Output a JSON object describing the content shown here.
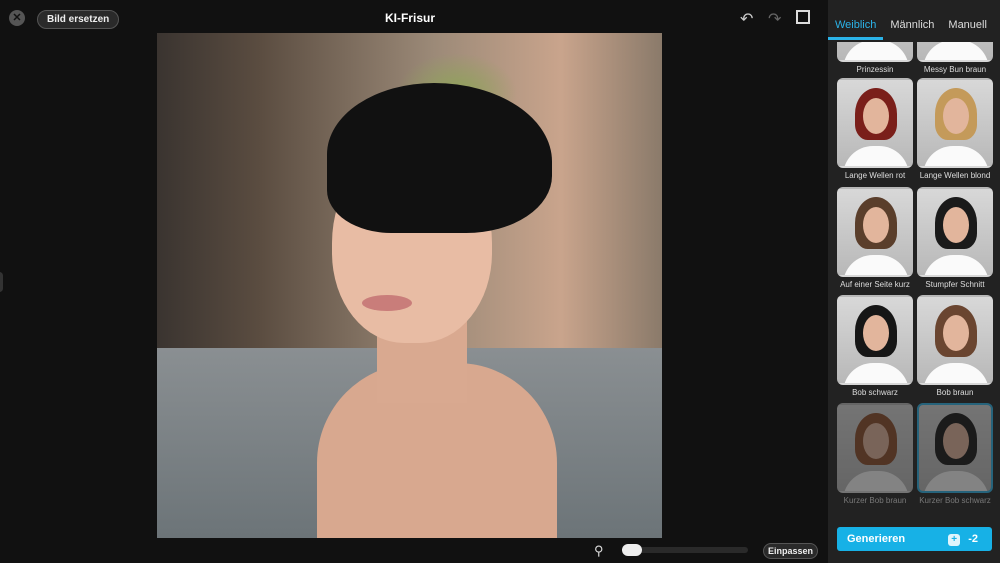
{
  "header": {
    "close_icon": "close-icon",
    "replace_label": "Bild ersetzen",
    "title": "KI-Frisur",
    "undo_icon": "undo-icon",
    "redo_icon": "redo-icon",
    "compare_icon": "compare-icon"
  },
  "canvas": {
    "zoom_icon": "search-icon",
    "zoom_level": 0,
    "fit_label": "Einpassen"
  },
  "panel": {
    "tabs": [
      {
        "label": "Weiblich",
        "active": true
      },
      {
        "label": "Männlich"
      },
      {
        "label": "Manuell"
      }
    ],
    "styles": [
      {
        "label": "Prinzessin",
        "hair": "#6b4a33"
      },
      {
        "label": "Messy Bun braun",
        "hair": "#5a3e2b"
      },
      {
        "label": "Lange Wellen rot",
        "hair": "#7a1f1a"
      },
      {
        "label": "Lange Wellen blond",
        "hair": "#c49a5a"
      },
      {
        "label": "Auf einer Seite kurz",
        "hair": "#5a3e2b"
      },
      {
        "label": "Stumpfer Schnitt",
        "hair": "#1a1a1a"
      },
      {
        "label": "Bob schwarz",
        "hair": "#161616"
      },
      {
        "label": "Bob braun",
        "hair": "#6a4530"
      },
      {
        "label": "Kurzer Bob braun",
        "hair": "#8a4a28"
      },
      {
        "label": "Kurzer Bob schwarz",
        "hair": "#141414",
        "selected": true
      }
    ],
    "generate_label": "Generieren",
    "cost": "-2",
    "accent": "#17b1e6"
  }
}
